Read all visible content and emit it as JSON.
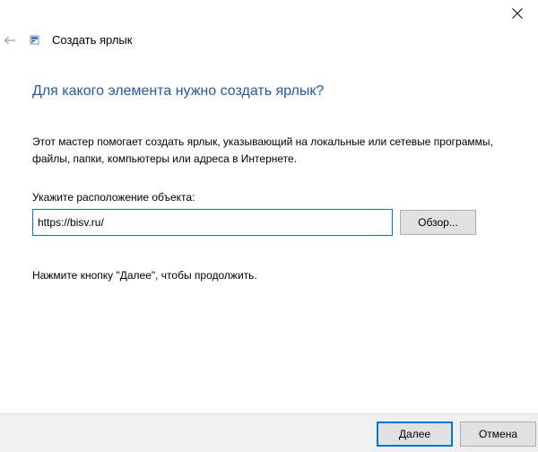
{
  "window": {
    "title": "Создать ярлык",
    "close_icon": "close-icon",
    "back_icon": "back-arrow-icon",
    "app_icon": "shortcut-icon"
  },
  "main": {
    "heading": "Для какого элемента нужно создать ярлык?",
    "description": "Этот мастер помогает создать ярлык, указывающий на локальные или сетевые программы, файлы, папки, компьютеры или адреса в Интернете.",
    "location_label": "Укажите расположение объекта:",
    "location_value": "https://bisv.ru/",
    "browse_label": "Обзор...",
    "hint": "Нажмите кнопку \"Далее\", чтобы продолжить."
  },
  "footer": {
    "next_label": "Далее",
    "cancel_label": "Отмена"
  },
  "colors": {
    "heading": "#2157b2",
    "focus": "#0078d7",
    "footer_bg": "#f0f0f0"
  }
}
